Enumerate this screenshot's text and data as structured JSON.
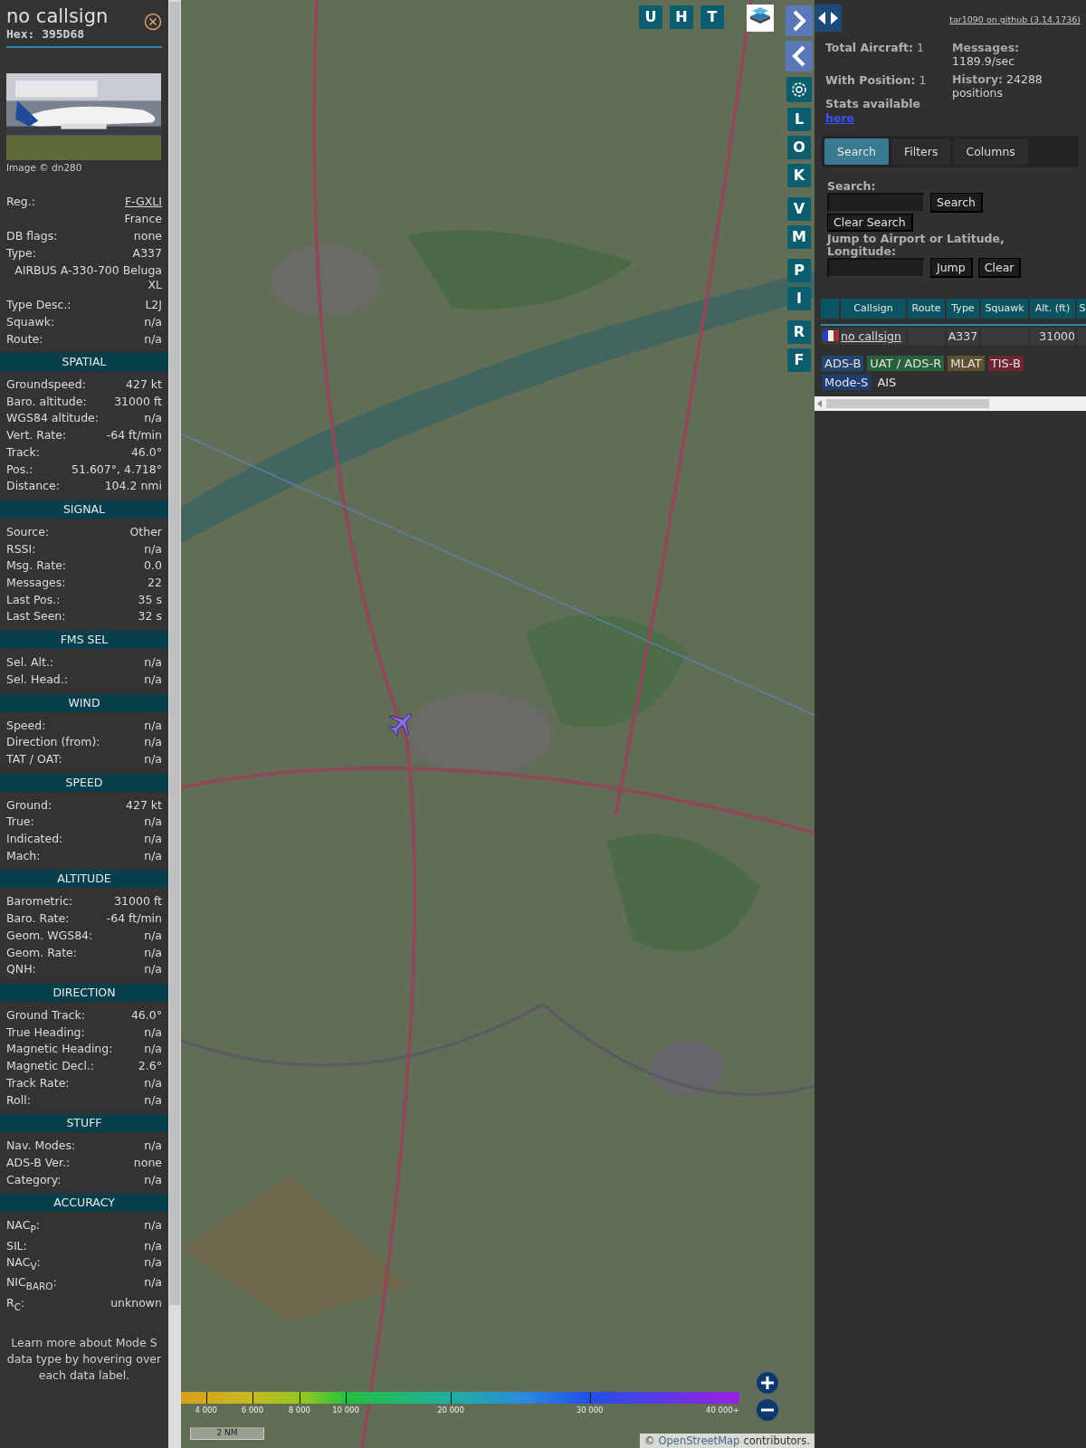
{
  "detail": {
    "title": "no callsign",
    "hex": "Hex: 395D68",
    "image_credit": "Image © dn280",
    "info_rows": [
      {
        "kind": "pair",
        "label": "Reg.:",
        "value": "F-GXLI",
        "link": true
      },
      {
        "kind": "pair",
        "value": "France",
        "link": false
      },
      {
        "kind": "pair",
        "label": "DB flags:",
        "value": "none",
        "link": false
      },
      {
        "kind": "pair",
        "label": "Type:",
        "value": "A337",
        "link": false
      },
      {
        "kind": "wide",
        "value": "AIRBUS A-330-700 Beluga XL"
      },
      {
        "kind": "pair",
        "label": "Type Desc.:",
        "value": "L2J",
        "link": false
      },
      {
        "kind": "pair",
        "label": "Squawk:",
        "value": "n/a",
        "link": false
      },
      {
        "kind": "pair",
        "label": "Route:",
        "value": "n/a",
        "link": false
      }
    ],
    "sections": [
      {
        "title": "SPATIAL",
        "rows": [
          {
            "label": "Groundspeed:",
            "value": "427 kt"
          },
          {
            "label": "Baro. altitude:",
            "value": "31000 ft"
          },
          {
            "label": "WGS84 altitude:",
            "value": "n/a"
          },
          {
            "label": "Vert. Rate:",
            "value": "-64 ft/min"
          },
          {
            "label": "Track:",
            "value": "46.0°"
          },
          {
            "label": "Pos.:",
            "value": "51.607°, 4.718°"
          },
          {
            "label": "Distance:",
            "value": "104.2 nmi"
          }
        ]
      },
      {
        "title": "SIGNAL",
        "rows": [
          {
            "label": "Source:",
            "value": "Other"
          },
          {
            "label": "RSSI:",
            "value": "n/a"
          },
          {
            "label": "Msg. Rate:",
            "value": "0.0"
          },
          {
            "label": "Messages:",
            "value": "22"
          },
          {
            "label": "Last Pos.:",
            "value": "35 s"
          },
          {
            "label": "Last Seen:",
            "value": "32 s"
          }
        ]
      },
      {
        "title": "FMS SEL",
        "rows": [
          {
            "label": "Sel. Alt.:",
            "value": "n/a"
          },
          {
            "label": "Sel. Head.:",
            "value": "n/a"
          }
        ]
      },
      {
        "title": "WIND",
        "rows": [
          {
            "label": "Speed:",
            "value": "n/a"
          },
          {
            "label": "Direction (from):",
            "value": "n/a"
          },
          {
            "label": "TAT / OAT:",
            "value": "n/a"
          }
        ]
      },
      {
        "title": "SPEED",
        "rows": [
          {
            "label": "Ground:",
            "value": "427 kt"
          },
          {
            "label": "True:",
            "value": "n/a"
          },
          {
            "label": "Indicated:",
            "value": "n/a"
          },
          {
            "label": "Mach:",
            "value": "n/a"
          }
        ]
      },
      {
        "title": "ALTITUDE",
        "rows": [
          {
            "label": "Barometric:",
            "value": "31000 ft"
          },
          {
            "label": "Baro. Rate:",
            "value": "-64 ft/min"
          },
          {
            "label": "Geom. WGS84:",
            "value": "n/a"
          },
          {
            "label": "Geom. Rate:",
            "value": "n/a"
          },
          {
            "label": "QNH:",
            "value": "n/a"
          }
        ]
      },
      {
        "title": "DIRECTION",
        "rows": [
          {
            "label": "Ground Track:",
            "value": "46.0°"
          },
          {
            "label": "True Heading:",
            "value": "n/a"
          },
          {
            "label": "Magnetic Heading:",
            "value": "n/a"
          },
          {
            "label": "Magnetic Decl.:",
            "value": "2.6°"
          },
          {
            "label": "Track Rate:",
            "value": "n/a"
          },
          {
            "label": "Roll:",
            "value": "n/a"
          }
        ]
      },
      {
        "title": "STUFF",
        "rows": [
          {
            "label": "Nav. Modes:",
            "value": "n/a"
          },
          {
            "label": "ADS-B Ver.:",
            "value": "none"
          },
          {
            "label": "Category:",
            "value": "n/a"
          }
        ]
      },
      {
        "title": "ACCURACY",
        "rows": [
          {
            "label": "NAC$_{P}$:",
            "value": "n/a"
          },
          {
            "label": "SIL:",
            "value": "n/a"
          },
          {
            "label": "NAC$_{V}$:",
            "value": "n/a"
          },
          {
            "label": "NIC$_{BARO}$:",
            "value": "n/a"
          },
          {
            "label": "R$_{C}$:",
            "value": "unknown"
          }
        ]
      }
    ],
    "note": "Learn more about Mode S data type by hovering over each data label."
  },
  "map": {
    "top_buttons": [
      "U",
      "H",
      "T"
    ],
    "side_button_groups": [
      [
        "L",
        "O",
        "K"
      ],
      [
        "V",
        "M"
      ],
      [
        "P",
        "I"
      ],
      [
        "R",
        "F"
      ]
    ],
    "legend": [
      "4 000",
      "6 000",
      "8 000",
      "10 000",
      "20 000",
      "30 000",
      "40 000+"
    ],
    "scale": "2 NM",
    "attribution": {
      "prefix": "©",
      "link": "OpenStreetMap",
      "suffix": "contributors."
    }
  },
  "panel": {
    "version_link": "tar1090 on github (3.14.1736)",
    "stats_left": [
      "**Total Aircraft:** 1",
      "**With Position:** 1"
    ],
    "stats_label": "Stats available",
    "stats_link": "here",
    "stats_right": [
      "**Messages:** 1189.9/sec",
      "**History:** 24288 positions"
    ],
    "tabs": [
      {
        "label": "Search",
        "selected": true
      },
      {
        "label": "Filters",
        "selected": false
      },
      {
        "label": "Columns",
        "selected": false
      }
    ],
    "search_label": "Search:",
    "search_button": "Search",
    "clear_search_button": "Clear Search",
    "jump_label": "Jump to Airport or Latitude, Longitude:",
    "jump_button": "Jump",
    "clear_button": "Clear",
    "table": {
      "columns": [
        "Callsign",
        "Route",
        "Type",
        "Squawk",
        "Alt. (ft)",
        "S"
      ],
      "rows": [
        {
          "callsign": "no callsign",
          "type": "A337",
          "altitude": "31000"
        }
      ]
    },
    "source_tags": [
      {
        "label": "ADS-B",
        "color": "#24466e"
      },
      {
        "label": "UAT / ADS-R",
        "color": "#27603a"
      },
      {
        "label": "MLAT",
        "color": "#5c5230"
      },
      {
        "label": "TIS-B",
        "color": "#6e2531"
      },
      {
        "label": "Mode-S",
        "color": "#1f3d73"
      },
      {
        "label": "AIS",
        "color": "#303030"
      }
    ]
  }
}
